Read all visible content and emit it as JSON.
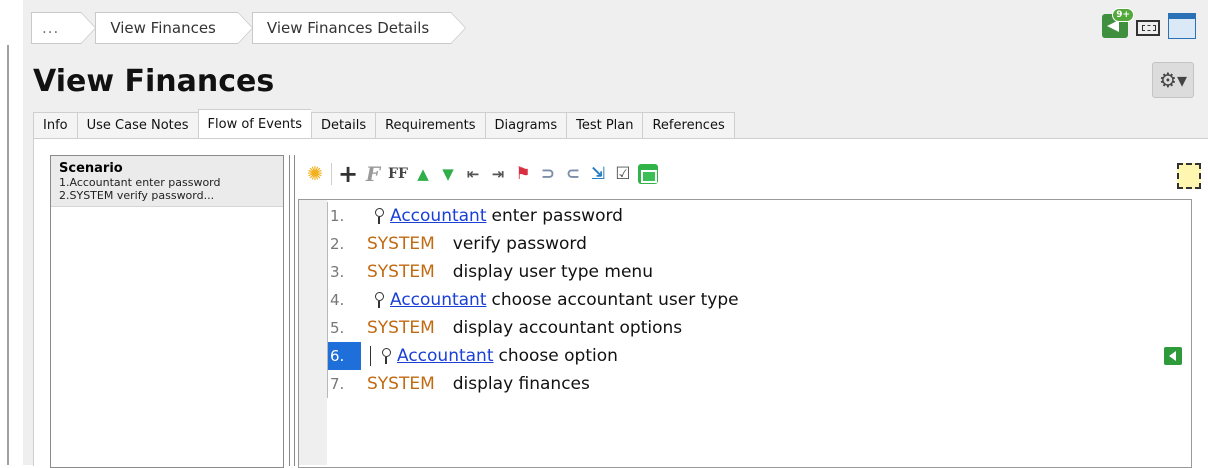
{
  "breadcrumb": [
    "...",
    "View Finances",
    "View Finances Details"
  ],
  "notifications": {
    "badge": "9+"
  },
  "page_title": "View Finances",
  "settings_icon": "gear-icon",
  "tabs": [
    {
      "label": "Info"
    },
    {
      "label": "Use Case Notes"
    },
    {
      "label": "Flow of Events",
      "active": true
    },
    {
      "label": "Details"
    },
    {
      "label": "Requirements"
    },
    {
      "label": "Diagrams"
    },
    {
      "label": "Test Plan"
    },
    {
      "label": "References"
    }
  ],
  "scenario": {
    "title": "Scenario",
    "lines": [
      "1.Accountant enter password",
      "2.SYSTEM verify password..."
    ]
  },
  "toolbar_icons": [
    "new-step-icon",
    "add-icon",
    "format-italic-icon",
    "format-font-icon",
    "move-up-icon",
    "move-down-icon",
    "outdent-icon",
    "indent-icon",
    "flag-icon",
    "loop-back-icon",
    "loop-forward-icon",
    "insert-link-icon",
    "checklist-icon",
    "home-icon",
    "edit-frame-icon"
  ],
  "flow": {
    "steps": [
      {
        "num": "1.",
        "type": "actor",
        "actor": "Accountant",
        "text": "enter password"
      },
      {
        "num": "2.",
        "type": "system",
        "actor": "SYSTEM",
        "text": "verify password"
      },
      {
        "num": "3.",
        "type": "system",
        "actor": "SYSTEM",
        "text": "display user type menu"
      },
      {
        "num": "4.",
        "type": "actor",
        "actor": "Accountant",
        "text": "choose accountant user type"
      },
      {
        "num": "5.",
        "type": "system",
        "actor": "SYSTEM",
        "text": "display accountant options"
      },
      {
        "num": "6.",
        "type": "actor",
        "actor": "Accountant",
        "text": "choose option",
        "selected": true
      },
      {
        "num": "7.",
        "type": "system",
        "actor": "SYSTEM",
        "text": "display finances"
      }
    ]
  },
  "colors": {
    "system": "#c06a12",
    "actor_link": "#1a3fd6",
    "selection": "#1e6fd9",
    "accent_green": "#2e9a3a"
  }
}
